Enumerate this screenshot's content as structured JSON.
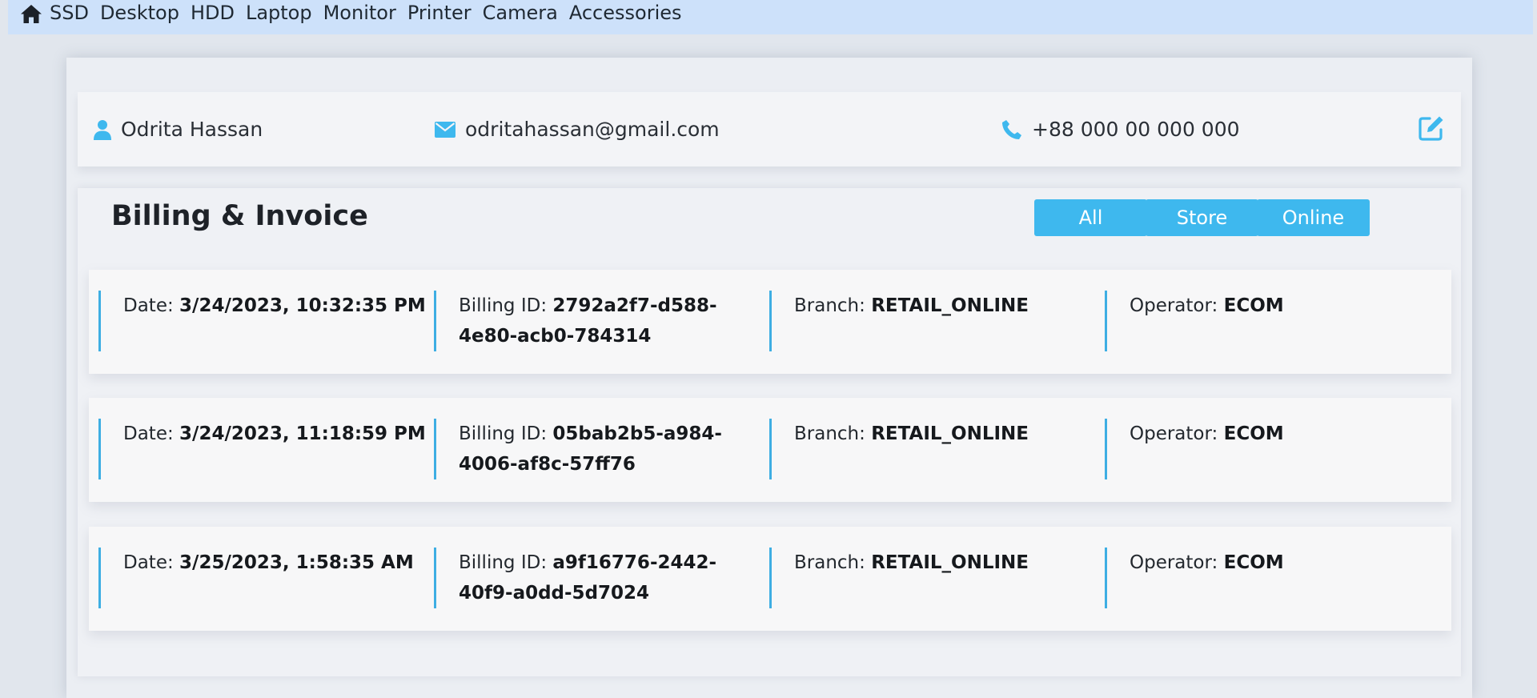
{
  "nav": {
    "home_icon": "home-icon",
    "items": [
      "SSD",
      "Desktop",
      "HDD",
      "Laptop",
      "Monitor",
      "Printer",
      "Camera",
      "Accessories"
    ]
  },
  "profile": {
    "name": "Odrita Hassan",
    "email": "odritahassan@gmail.com",
    "phone": "+88 000 00 000 000",
    "icons": [
      "user-icon",
      "envelope-icon",
      "phone-icon",
      "edit-icon"
    ]
  },
  "billing": {
    "title": "Billing & Invoice",
    "filters": [
      "All",
      "Store",
      "Online"
    ],
    "labels": {
      "date": "Date:",
      "billing_id": "Billing ID:",
      "branch": "Branch:",
      "operator": "Operator:"
    },
    "records": [
      {
        "date": "3/24/2023, 10:32:35 PM",
        "billing_id_line1": "2792a2f7-d588-",
        "billing_id_line2": "4e80-acb0-784314",
        "branch": "RETAIL_ONLINE",
        "operator": "ECOM"
      },
      {
        "date": "3/24/2023, 11:18:59 PM",
        "billing_id_line1": "05bab2b5-a984-",
        "billing_id_line2": "4006-af8c-57ff76",
        "branch": "RETAIL_ONLINE",
        "operator": "ECOM"
      },
      {
        "date": "3/25/2023, 1:58:35 AM",
        "billing_id_line1": "a9f16776-2442-",
        "billing_id_line2": "40f9-a0dd-5d7024",
        "branch": "RETAIL_ONLINE",
        "operator": "ECOM"
      }
    ]
  },
  "colors": {
    "accent": "#3eb8ee",
    "nav_bg": "#cde1fa",
    "page_bg": "#e1e6ed"
  }
}
